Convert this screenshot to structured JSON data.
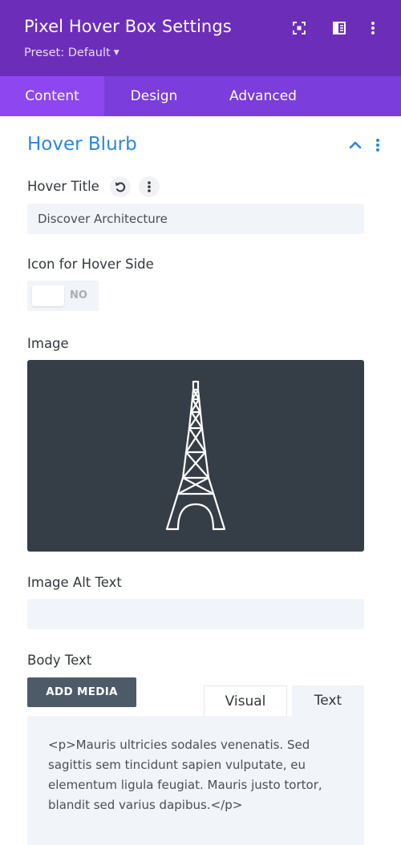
{
  "header": {
    "title": "Pixel Hover Box Settings",
    "preset": "Preset: Default"
  },
  "colors": {
    "header_bg": "#6c2eb9",
    "tabs_bg": "#7b3ddc",
    "active_tab_bg": "#8e47f0",
    "accent": "#2b87da",
    "image_bg": "#353d47"
  },
  "icons": {
    "header": [
      "focus-icon",
      "sidebar-layout-icon",
      "more-vertical-icon"
    ],
    "section": [
      "chevron-up-icon",
      "more-vertical-icon"
    ],
    "field": [
      "reset-icon",
      "more-vertical-icon"
    ],
    "image": "eiffel-tower-icon"
  },
  "tabs": [
    {
      "label": "Content",
      "active": true
    },
    {
      "label": "Design",
      "active": false
    },
    {
      "label": "Advanced",
      "active": false
    }
  ],
  "section": {
    "title": "Hover Blurb",
    "expanded": true
  },
  "fields": {
    "hover_title": {
      "label": "Hover Title",
      "value": "Discover Architecture"
    },
    "icon_for_hover_side": {
      "label": "Icon for Hover Side",
      "state": "NO"
    },
    "image": {
      "label": "Image"
    },
    "image_alt_text": {
      "label": "Image Alt Text",
      "value": ""
    },
    "body_text": {
      "label": "Body Text",
      "add_media_label": "ADD MEDIA",
      "editor_tabs": [
        "Visual",
        "Text"
      ],
      "active_editor_tab": "Text",
      "content": "<p>Mauris ultricies sodales venenatis. Sed sagittis sem tincidunt sapien vulputate, eu elementum ligula feugiat. Mauris justo tortor, blandit sed varius dapibus.</p>"
    }
  }
}
